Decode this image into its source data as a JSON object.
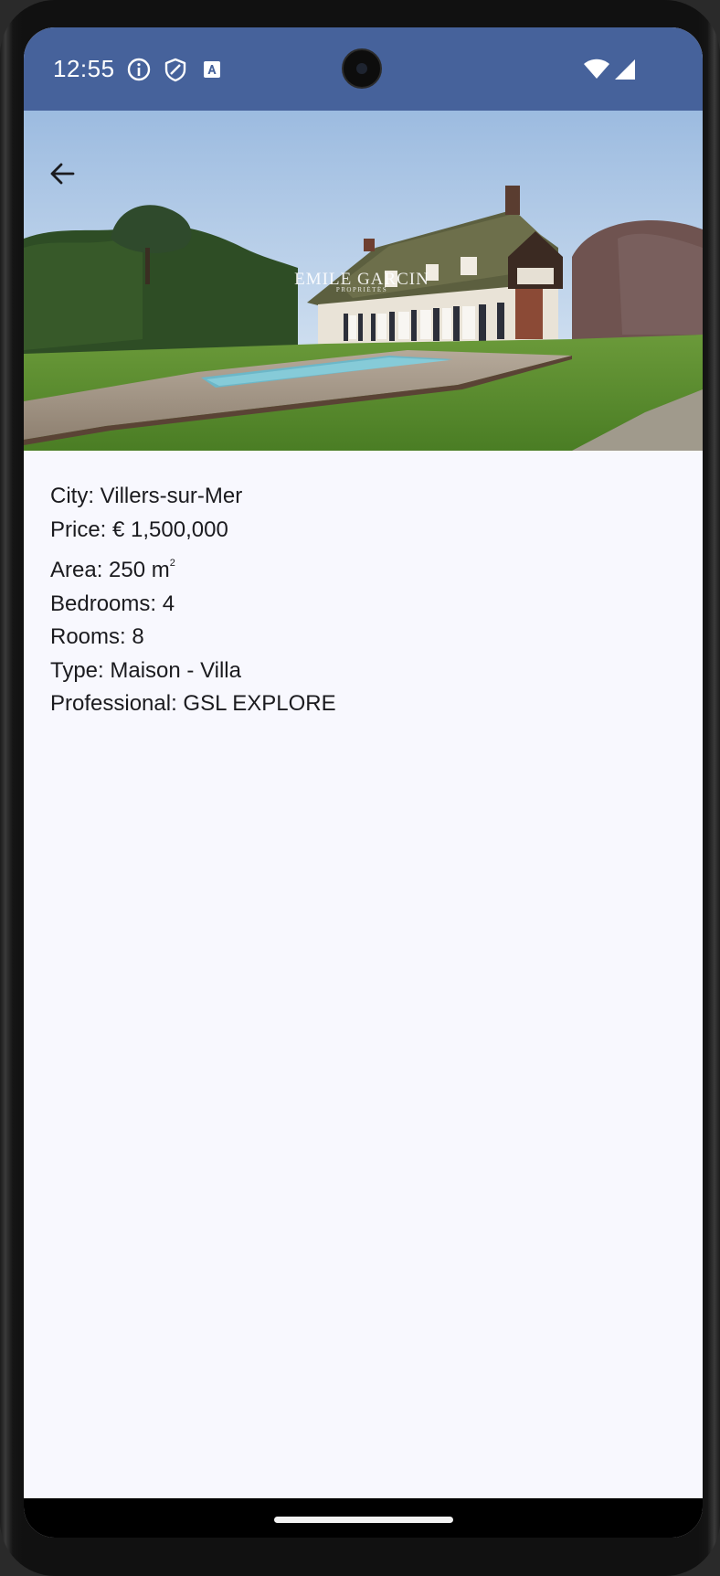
{
  "status_bar": {
    "time": "12:55",
    "icons": [
      "info-icon",
      "shield-icon",
      "translate-icon",
      "wifi-icon",
      "signal-icon"
    ]
  },
  "colors": {
    "status_bar": "#46629b",
    "background": "#f8f8fe",
    "text": "#1b1b1f"
  },
  "hero": {
    "watermark_title": "EMILE GARCIN",
    "watermark_subtitle": "PROPRIÉTÉS"
  },
  "toolbar": {
    "back_icon": "arrow-left-icon"
  },
  "property": {
    "city": "City: Villers-sur-Mer",
    "price": "Price: € 1,500,000",
    "area_prefix": "Area: 250 m",
    "area_sup": "2",
    "bedrooms": "Bedrooms: 4",
    "rooms": "Rooms: 8",
    "type": "Type: Maison - Villa",
    "professional": "Professional: GSL EXPLORE"
  }
}
